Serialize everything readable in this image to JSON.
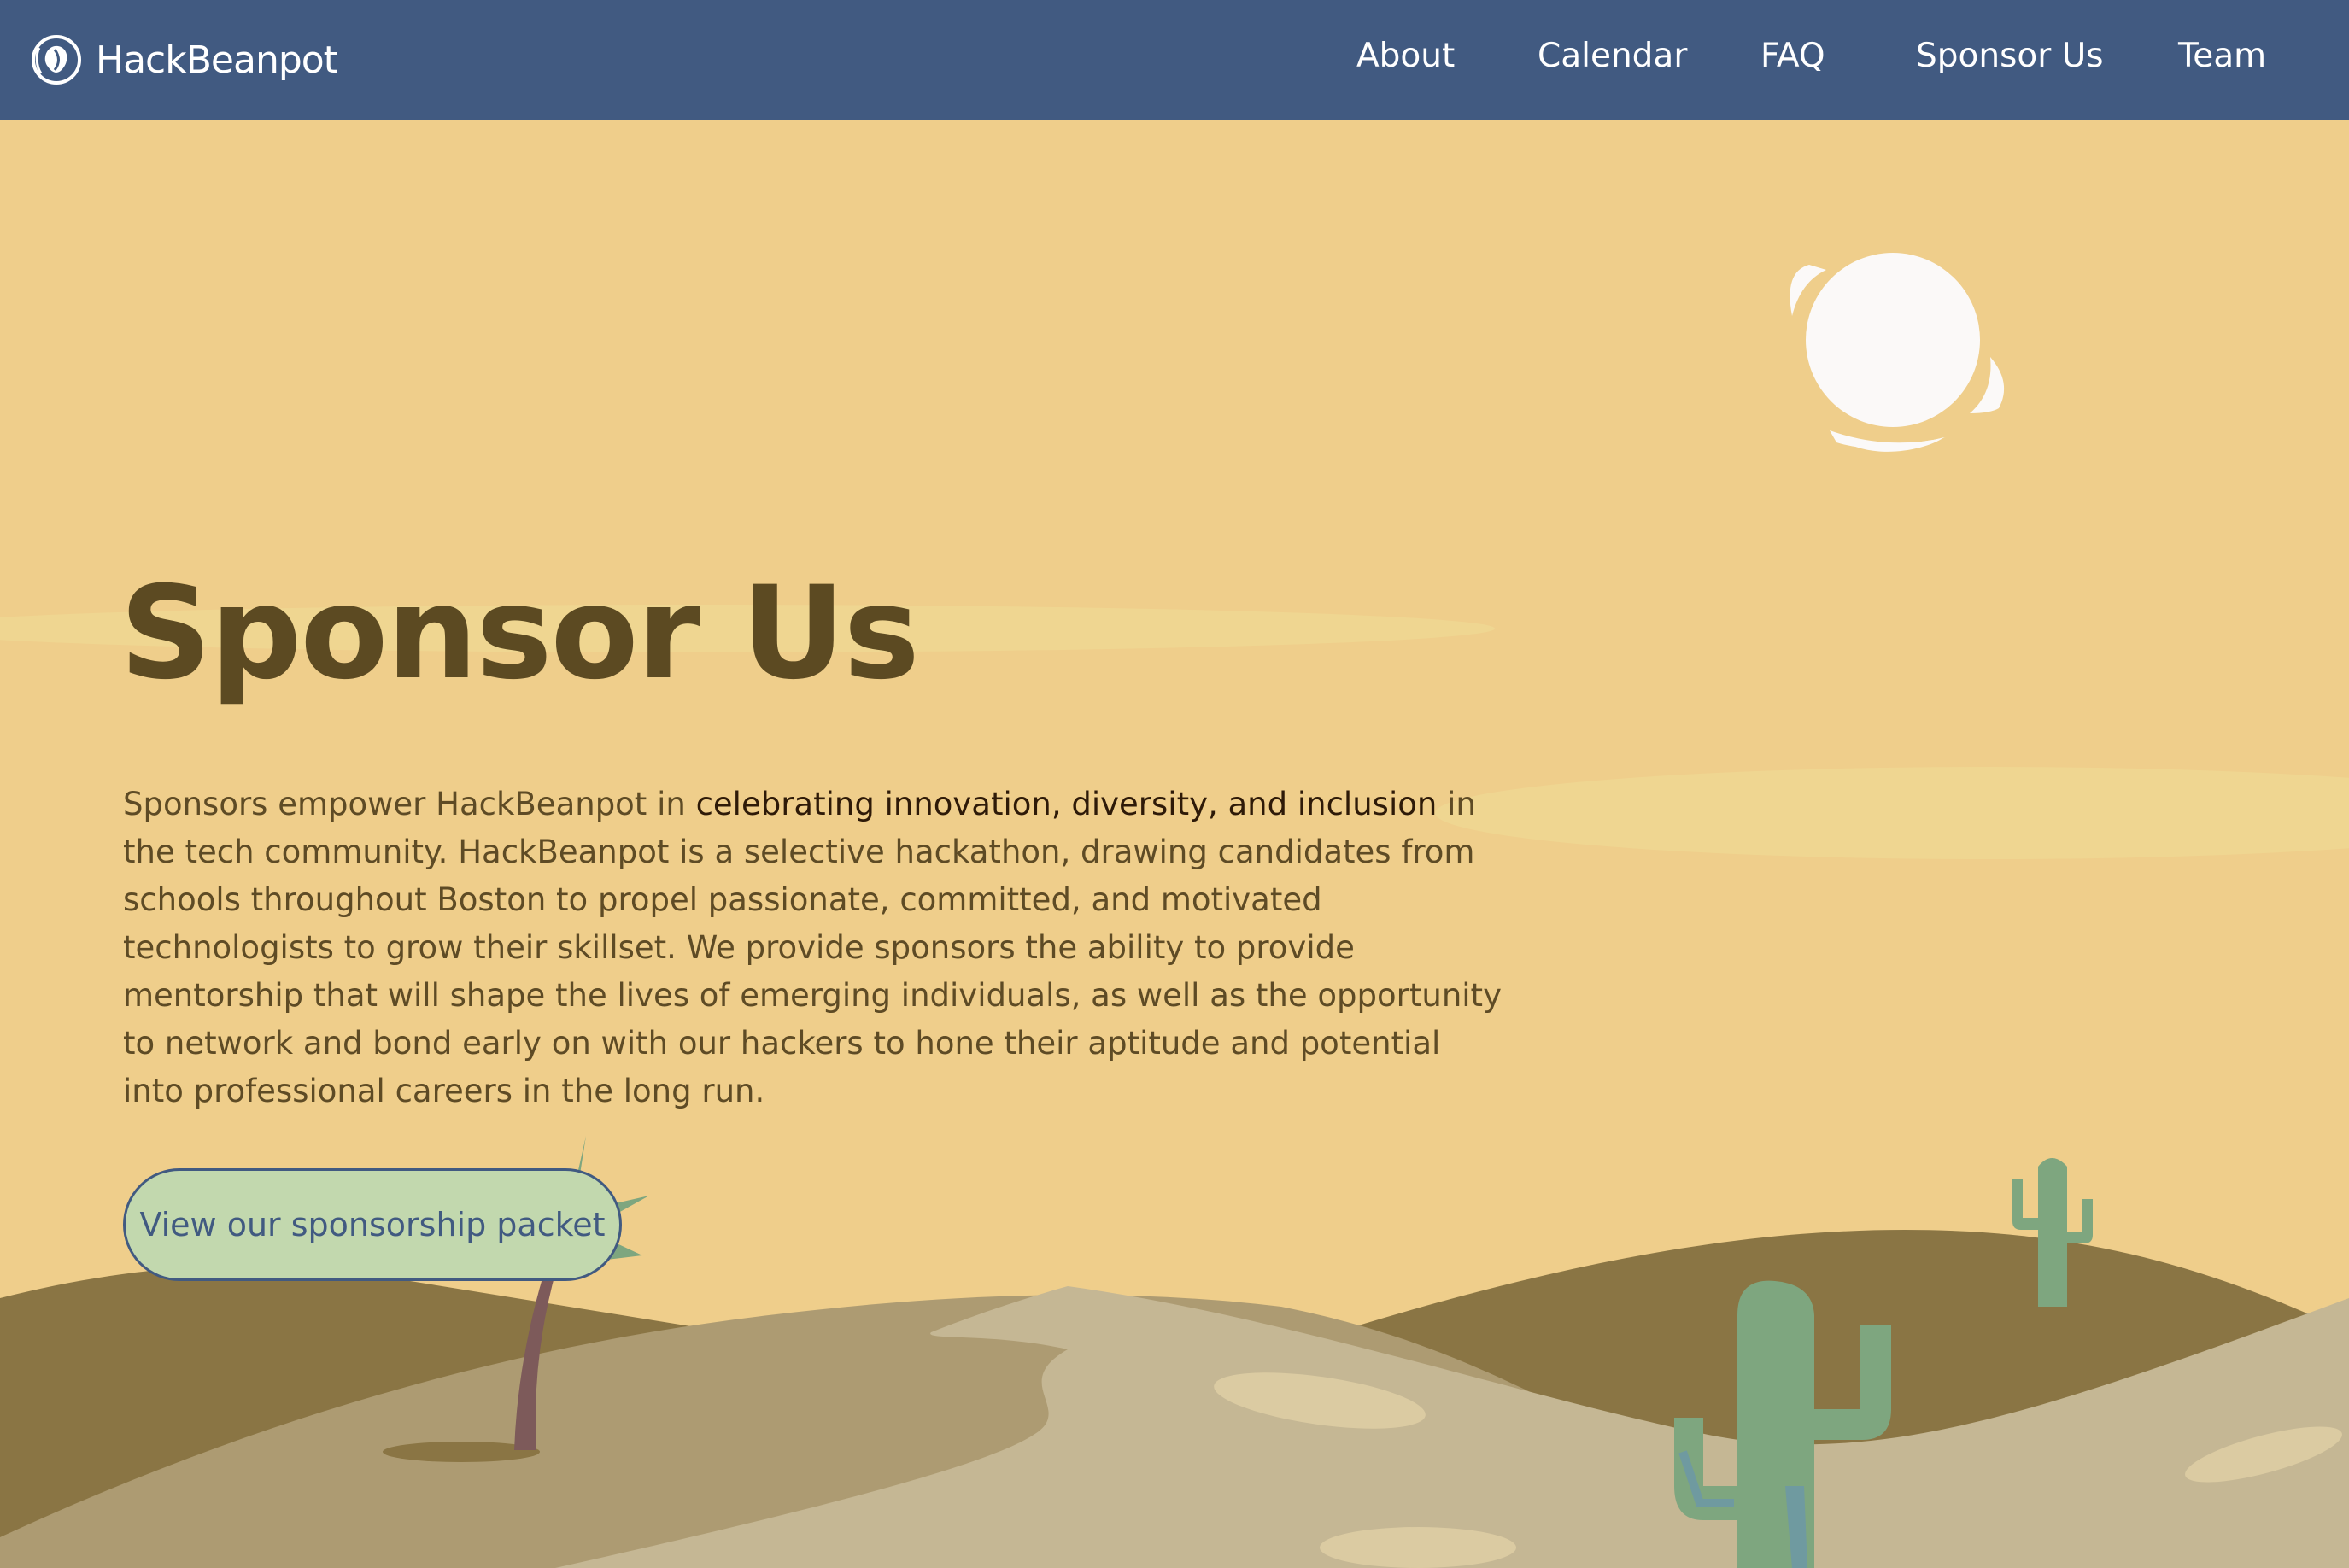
{
  "nav": {
    "brand": "HackBeanpot",
    "links": [
      "About",
      "Calendar",
      "FAQ",
      "Sponsor Us",
      "Team"
    ]
  },
  "hero": {
    "title": "Sponsor Us",
    "text_before": "Sponsors empower HackBeanpot in ",
    "text_highlight": "celebrating innovation, diversity, and inclusion",
    "text_after": " in the tech community. HackBeanpot is a selective hackathon, drawing candidates from schools throughout Boston to propel passionate, committed, and motivated technologists to grow their skillset. We provide sponsors the ability to provide mentorship that will shape the lives of emerging individuals, as well as the opportunity to network and bond early on with our hackers to hone their aptitude and potential into professional careers in the long run.",
    "cta_label": "View our sponsorship packet"
  },
  "colors": {
    "nav_background": "#415a81",
    "sky": "#efce8b",
    "title": "#5c4a22",
    "body_text": "#5e4b25",
    "highlight_text": "#2e1a08",
    "cta_background": "#c2d8ae",
    "cta_text": "#415a81",
    "sun": "#fbf9f8",
    "cactus": "#7ea67f",
    "far_dune": "#8a7544",
    "mid_dune": "#ad9b72",
    "near_dune": "#c5b794"
  },
  "icons": [
    "bean-logo-icon",
    "sun-icon",
    "palm-tree-icon",
    "cactus-icon"
  ]
}
